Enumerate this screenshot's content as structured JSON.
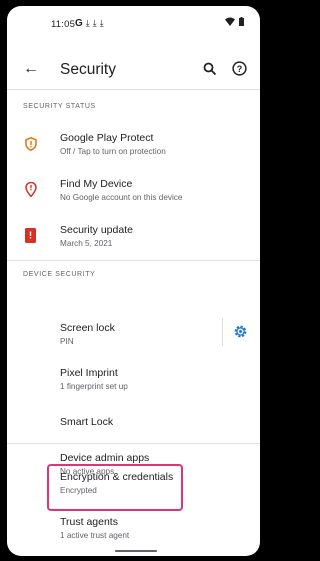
{
  "status_bar": {
    "time": "11:05"
  },
  "app_bar": {
    "title": "Security"
  },
  "sections": {
    "security_status": "SECURITY STATUS",
    "device_security": "DEVICE SECURITY"
  },
  "items": [
    {
      "title": "Google Play Protect",
      "subtitle": "Off / Tap to turn on protection"
    },
    {
      "title": "Find My Device",
      "subtitle": "No Google account on this device"
    },
    {
      "title": "Security update",
      "subtitle": "March 5, 2021"
    },
    {
      "title": "Screen lock",
      "subtitle": "PIN"
    },
    {
      "title": "Pixel Imprint",
      "subtitle": "1 fingerprint set up"
    },
    {
      "title": "Smart Lock",
      "subtitle": ""
    },
    {
      "title": "Device admin apps",
      "subtitle": "No active apps"
    },
    {
      "title": "Encryption & credentials",
      "subtitle": "Encrypted"
    },
    {
      "title": "Trust agents",
      "subtitle": "1 active trust agent"
    }
  ],
  "colors": {
    "warning": "#e8710a",
    "danger": "#d93025",
    "accent": "#1a73e8",
    "highlight": "#e0337a"
  }
}
